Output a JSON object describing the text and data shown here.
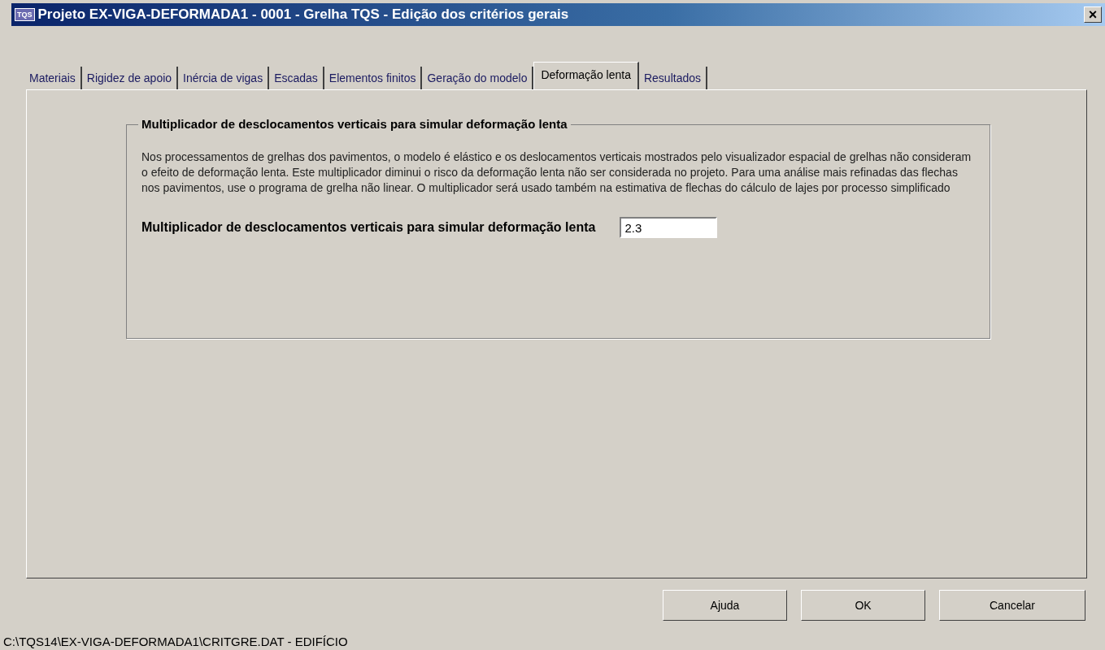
{
  "window": {
    "title": "Projeto EX-VIGA-DEFORMADA1 - 0001 - Grelha TQS - Edição dos critérios gerais",
    "app_icon_text": "TQS",
    "close": "×"
  },
  "tabs": [
    {
      "label": "Materiais",
      "selected": false
    },
    {
      "label": "Rigidez de apoio",
      "selected": false
    },
    {
      "label": "Inércia  de vigas",
      "selected": false
    },
    {
      "label": "Escadas",
      "selected": false
    },
    {
      "label": "Elementos finitos",
      "selected": false
    },
    {
      "label": "Geração do modelo",
      "selected": false
    },
    {
      "label": "Deformação lenta",
      "selected": true
    },
    {
      "label": "Resultados",
      "selected": false
    }
  ],
  "group": {
    "title": "Multiplicador de desclocamentos verticais para simular deformação lenta",
    "description": "Nos processamentos de grelhas dos pavimentos, o modelo é elástico e os deslocamentos verticais mostrados pelo visualizador espacial de grelhas não consideram o efeito de deformação lenta. Este multiplicador diminui o risco da deformação lenta não ser considerada no projeto. Para uma análise mais refinadas das flechas nos pavimentos, use o programa de grelha não linear. O multiplicador será usado também na estimativa de flechas do cálculo de lajes por processo simplificado",
    "field": {
      "label": "Multiplicador de desclocamentos verticais para simular deformação lenta",
      "value": "2.3"
    }
  },
  "buttons": [
    "Ajuda",
    "OK",
    "Cancelar"
  ],
  "status_bar": "C:\\TQS14\\EX-VIGA-DEFORMADA1\\CRITGRE.DAT - EDIFÍCIO"
}
